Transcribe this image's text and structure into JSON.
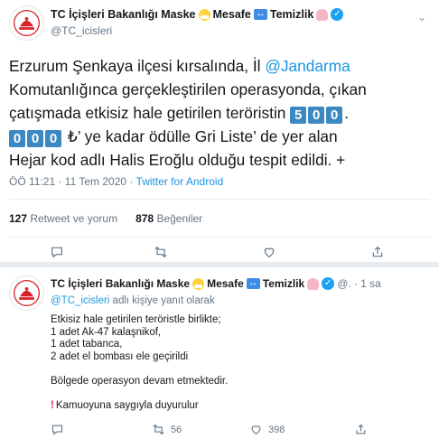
{
  "main_tweet": {
    "name": "TC İçişleri Bakanlığı Maske",
    "name_mid": "Mesafe",
    "name_end": "Temizlik",
    "handle": "@TC_icisleri",
    "text": {
      "l1_pre": "Erzurum Şenkaya ilçesi kırsalında, İl ",
      "l1_mention": "@Jandarma",
      "l2": "Komutanlığınca gerçekleştirilen operasyonda, çıkan",
      "l3_pre": "çatışmada etkisiz hale getirilen teröristin ",
      "l3_digits": [
        "5",
        "0",
        "0"
      ],
      "l3_post": ".",
      "l4_digits": [
        "0",
        "0",
        "0"
      ],
      "l4_post": " ₺’  ye kadar ödülle Gri Liste’  de yer alan",
      "l5": "Hejar kod adlı Halis Eroğlu olduğu tespit edildi. +"
    },
    "time": "ÖÖ 11:21 · 11 Tem 2020 · ",
    "source": "Twitter for Android",
    "retweets": "127",
    "retweets_label": " Retweet ve yorum",
    "likes": "878",
    "likes_label": " Beğeniler"
  },
  "reply_tweet": {
    "name": "TC İçişleri Bakanlığı Maske",
    "name_mid": "Mesafe",
    "name_end": "Temizlik",
    "handle_trunc": "@.",
    "time": "· 1 sa",
    "reply_to": "@TC_icisleri",
    "reply_to_suffix": " adlı kişiye yanıt olarak",
    "lines": [
      "Etkisiz hale getirilen teröristle birlikte;",
      "1 adet Ak-47 kalaşnikof,",
      "1 adet tabanca,",
      "2 adet el bombası ele geçirildi"
    ],
    "line_ops": "Bölgede operasyon devam etmektedir.",
    "line_notice": "Kamuoyuna saygıyla duyurulur",
    "retweet_count": "56",
    "like_count": "398"
  },
  "colors": {
    "link": "#1b95e0",
    "muted": "#657786",
    "verified": "#1da1f2",
    "keycap": "#3b88c3"
  }
}
